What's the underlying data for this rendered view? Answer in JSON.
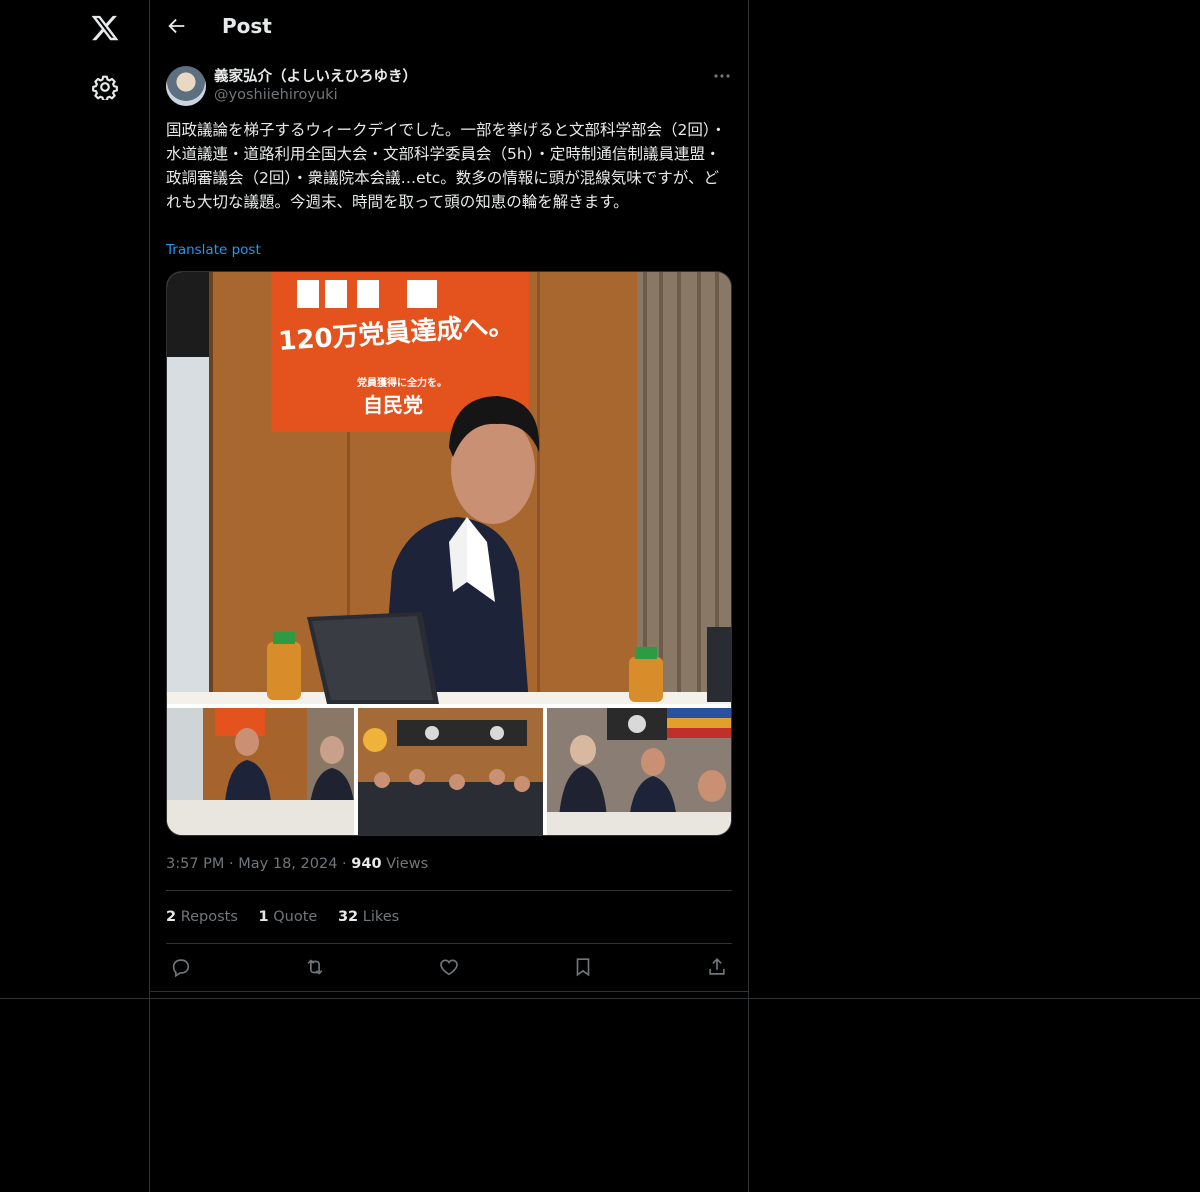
{
  "header": {
    "title": "Post",
    "back_icon": "arrow-left-icon"
  },
  "rail": {
    "logo": "x-logo-icon",
    "settings_icon": "gear-icon"
  },
  "post": {
    "author_name": "義家弘介（よしいえひろゆき）",
    "author_handle": "@yoshiiehiroyuki",
    "text": "国政議論を梯子するウィークデイでした。一部を挙げると文部科学部会（2回）・水道議連・道路利用全国大会・文部科学委員会（5h）・定時制通信制議員連盟・政調審議会（2回）・衆議院本会議…etc。数多の情報に頭が混線気味ですが、どれも大切な議題。今週末、時間を取って頭の知恵の輪を解きます。",
    "translate_label": "Translate post",
    "image_banner_main": "120万党員達成へ。",
    "image_banner_sub": "党員獲得に全力を。",
    "image_banner_party": "自民党",
    "time": "3:57 PM",
    "date": "May 18, 2024",
    "views_count": "940",
    "views_label": "Views",
    "reposts_count": "2",
    "reposts_label": "Reposts",
    "quotes_count": "1",
    "quotes_label": "Quote",
    "likes_count": "32",
    "likes_label": "Likes",
    "separator": "·"
  },
  "actions": [
    "reply-icon",
    "repost-icon",
    "like-icon",
    "bookmark-icon",
    "share-icon"
  ],
  "colors": {
    "background": "#000000",
    "text": "#e7e9ea",
    "muted": "#71767b",
    "accent": "#1d9bf0",
    "border": "#2f3336"
  }
}
